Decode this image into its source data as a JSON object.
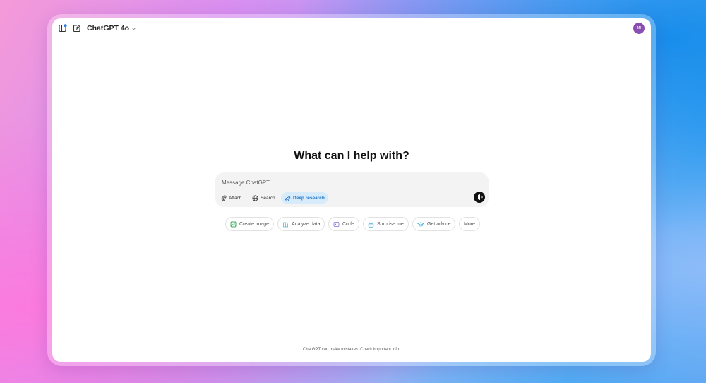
{
  "app": {
    "model_name": "ChatGPT 4o",
    "avatar_initials": "MI",
    "avatar_color": "#8a4fb0"
  },
  "main": {
    "heading": "What can I help with?"
  },
  "composer": {
    "placeholder": "Message ChatGPT",
    "tools": [
      {
        "label": "Attach",
        "icon": "paperclip-icon"
      },
      {
        "label": "Search",
        "icon": "globe-icon"
      },
      {
        "label": "Deep research",
        "icon": "telescope-icon",
        "active": true
      }
    ],
    "voice_button_icon": "voice-waveform-icon"
  },
  "suggestions": [
    {
      "label": "Create image",
      "icon": "image-icon",
      "icon_color": "#35a853"
    },
    {
      "label": "Analyze data",
      "icon": "chart-icon",
      "icon_color": "#4fb3d9"
    },
    {
      "label": "Code",
      "icon": "code-icon",
      "icon_color": "#7b6fd6"
    },
    {
      "label": "Surprise me",
      "icon": "gift-icon",
      "icon_color": "#4fb3d9"
    },
    {
      "label": "Get advice",
      "icon": "graduation-cap-icon",
      "icon_color": "#4fb3d9"
    },
    {
      "label": "More"
    }
  ],
  "footer": {
    "disclaimer": "ChatGPT can make mistakes. Check important info."
  },
  "colors": {
    "accent": "#1a73c8",
    "accent_bg": "#d7ebfb"
  }
}
